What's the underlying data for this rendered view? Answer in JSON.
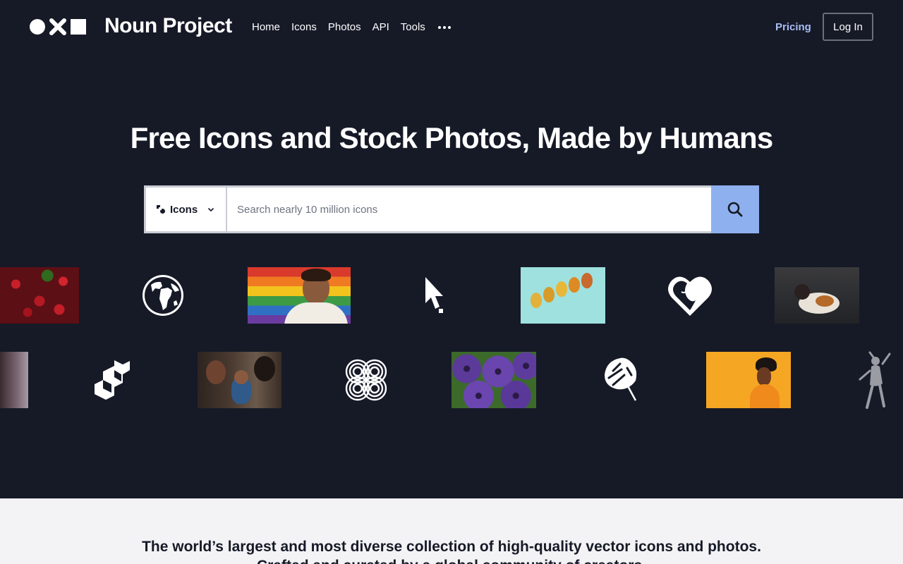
{
  "brand": {
    "name": "Noun Project"
  },
  "nav": {
    "items": [
      {
        "label": "Home"
      },
      {
        "label": "Icons"
      },
      {
        "label": "Photos"
      },
      {
        "label": "API"
      },
      {
        "label": "Tools"
      }
    ],
    "more_icon": "more-dots-icon",
    "pricing_label": "Pricing",
    "login_label": "Log In"
  },
  "hero": {
    "title": "Free Icons and Stock Photos, Made by Humans"
  },
  "search": {
    "type_label": "Icons",
    "placeholder": "Search nearly 10 million icons",
    "value": ""
  },
  "gallery": {
    "row1": [
      "cherries-photo",
      "globe-icon",
      "pride-portrait-photo",
      "cursor-icon",
      "pears-photo",
      "heart-face-icon",
      "cat-photo"
    ],
    "row2": [
      "partial-photo",
      "blocks-icon",
      "family-photo",
      "knot-icon",
      "petunias-photo",
      "monstera-leaf-icon",
      "yellow-portrait-photo",
      "dancer-icon"
    ]
  },
  "intro": {
    "line1": "The world’s largest and most diverse collection of high-quality vector icons and photos.",
    "line2": "Crafted and curated by a global community of creators."
  },
  "colors": {
    "background": "#161a27",
    "accent": "#8fb0ee",
    "pricing": "#a9bdf2",
    "intro_bg": "#f3f3f5"
  }
}
